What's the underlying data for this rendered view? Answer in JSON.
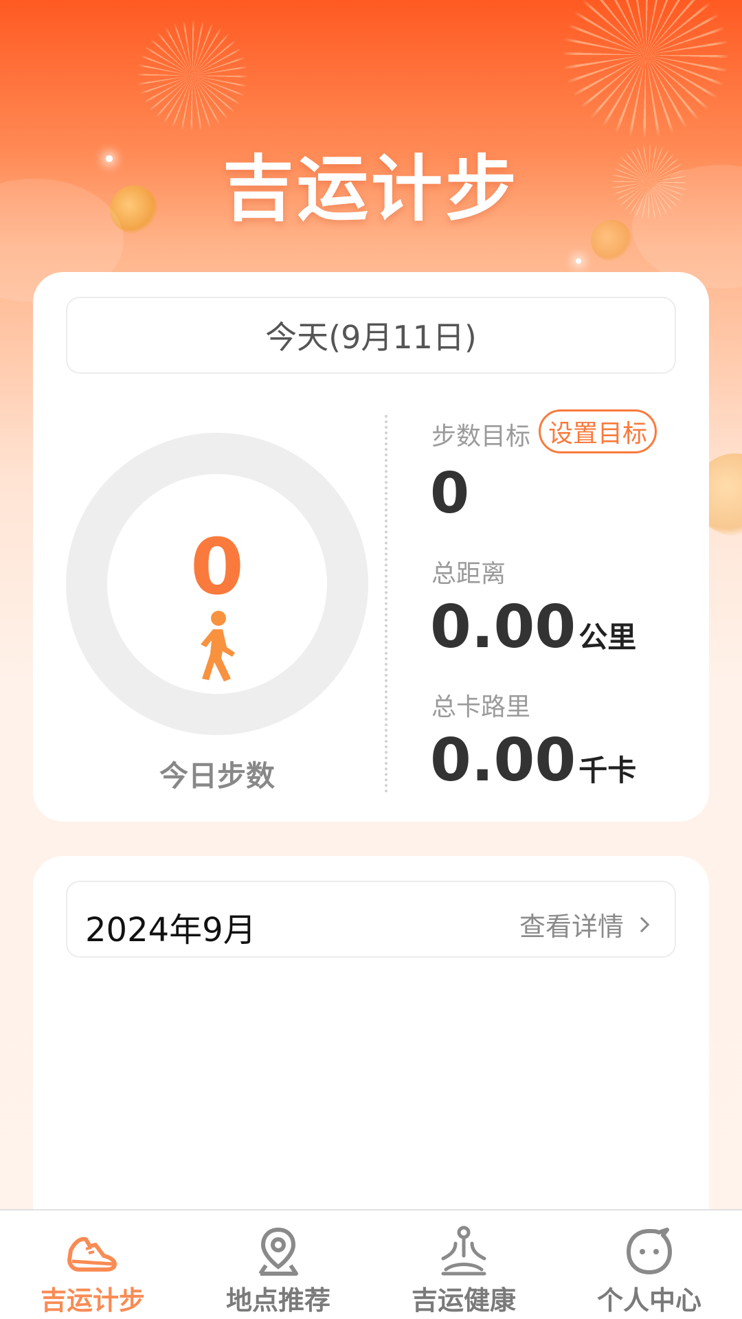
{
  "header": {
    "title": "吉运计步"
  },
  "today": {
    "date_label": "今天(9月11日)",
    "steps": "0",
    "steps_caption": "今日步数",
    "goal": {
      "label": "步数目标",
      "button": "设置目标",
      "value": "0"
    },
    "distance": {
      "label": "总距离",
      "value": "0.00",
      "unit": "公里"
    },
    "calories": {
      "label": "总卡路里",
      "value": "0.00",
      "unit": "千卡"
    }
  },
  "month": {
    "title": "2024年9月",
    "link": "查看详情"
  },
  "tabbar": {
    "items": [
      {
        "label": "吉运计步",
        "icon": "sneaker-icon",
        "active": true
      },
      {
        "label": "地点推荐",
        "icon": "location-pin-icon",
        "active": false
      },
      {
        "label": "吉运健康",
        "icon": "meditation-icon",
        "active": false
      },
      {
        "label": "个人中心",
        "icon": "face-icon",
        "active": false
      }
    ]
  },
  "colors": {
    "accent": "#f97a3c",
    "header_top": "#ff5a22",
    "ring_track": "#eeeeee"
  }
}
